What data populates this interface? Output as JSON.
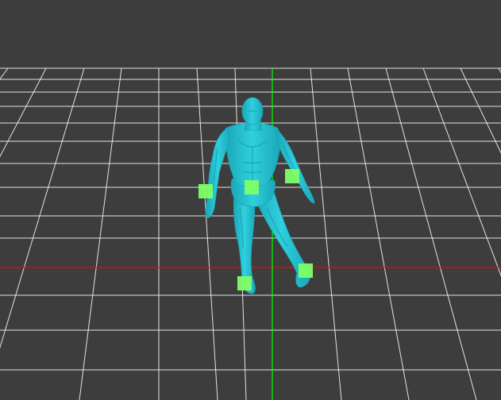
{
  "viewport": {
    "background_color": "#3d3d3d",
    "grid_color": "#ffffff",
    "x_axis_color": "#ff0000",
    "y_axis_color": "#00ff00"
  },
  "character": {
    "mesh_color": "#2fd0df",
    "mesh_shade_color": "#1aa7b8",
    "mesh_highlight_color": "#7ff2f7",
    "pose": "walking"
  },
  "ik_handles": {
    "color": "#80ff66",
    "items": [
      {
        "name": "hips-handle"
      },
      {
        "name": "right-hand-handle"
      },
      {
        "name": "left-hand-handle"
      },
      {
        "name": "right-foot-handle"
      },
      {
        "name": "left-foot-handle"
      }
    ]
  }
}
